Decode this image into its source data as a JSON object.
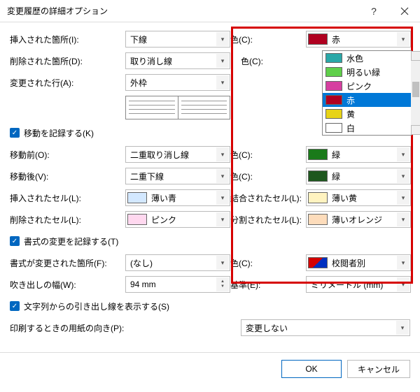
{
  "title": "変更履歴の詳細オプション",
  "rows": {
    "insertedLoc": {
      "label": "挿入された箇所(I):",
      "value": "下線"
    },
    "deletedLoc": {
      "label": "削除された箇所(D):",
      "value": "取り消し線"
    },
    "changedLine": {
      "label": "変更された行(A):",
      "value": "外枠"
    },
    "trackMoves": {
      "label": "移動を記録する(K)"
    },
    "moveBefore": {
      "label": "移動前(O):",
      "value": "二重取り消し線"
    },
    "moveAfter": {
      "label": "移動後(V):",
      "value": "二重下線"
    },
    "insertedCell": {
      "label": "挿入されたセル(L):",
      "value": "薄い青",
      "swatch": "#d3e8ff"
    },
    "deletedCell": {
      "label": "削除されたセル(L):",
      "value": "ピンク",
      "swatch": "#ffd8ef"
    },
    "trackFormat": {
      "label": "書式の変更を記録する(T)"
    },
    "formatChanged": {
      "label": "書式が変更された箇所(F):",
      "value": "(なし)"
    },
    "balloonWidth": {
      "label": "吹き出しの幅(W):",
      "value": "94 mm"
    },
    "showLeader": {
      "label": "文字列からの引き出し線を表示する(S)"
    },
    "paperOrient": {
      "label": "印刷するときの用紙の向き(P):",
      "value": "変更しない"
    }
  },
  "rightRows": {
    "color1": {
      "label": "色(C):",
      "value": "赤",
      "swatch": "#b00020"
    },
    "color2": {
      "label": "色(C):"
    },
    "color3": {
      "label": "色(C):",
      "value": "緑",
      "swatch": "#1a7a1a"
    },
    "color4": {
      "label": "色(C):",
      "value": "緑",
      "swatch": "#1e571e"
    },
    "mergedCell": {
      "label": "結合されたセル(L):",
      "value": "薄い黄",
      "swatch": "#fff3c0"
    },
    "splitCell": {
      "label": "分割されたセル(L):",
      "value": "薄いオレンジ",
      "swatch": "#fddcbb"
    },
    "color5": {
      "label": "色(C):",
      "value": "校閲者別",
      "swatch_style": "half-red-blue"
    },
    "measure": {
      "label": "基準(E):",
      "value": "ミリメートル (mm)"
    }
  },
  "dropdown": [
    {
      "label": "水色",
      "swatch": "#2aa8a8"
    },
    {
      "label": "明るい緑",
      "swatch": "#5fcf4a"
    },
    {
      "label": "ピンク",
      "swatch": "#d63fa0"
    },
    {
      "label": "赤",
      "swatch": "#b00020",
      "selected": true
    },
    {
      "label": "黄",
      "swatch": "#e7d316"
    },
    {
      "label": "白",
      "swatch": "#ffffff"
    }
  ],
  "buttons": {
    "ok": "OK",
    "cancel": "キャンセル"
  }
}
